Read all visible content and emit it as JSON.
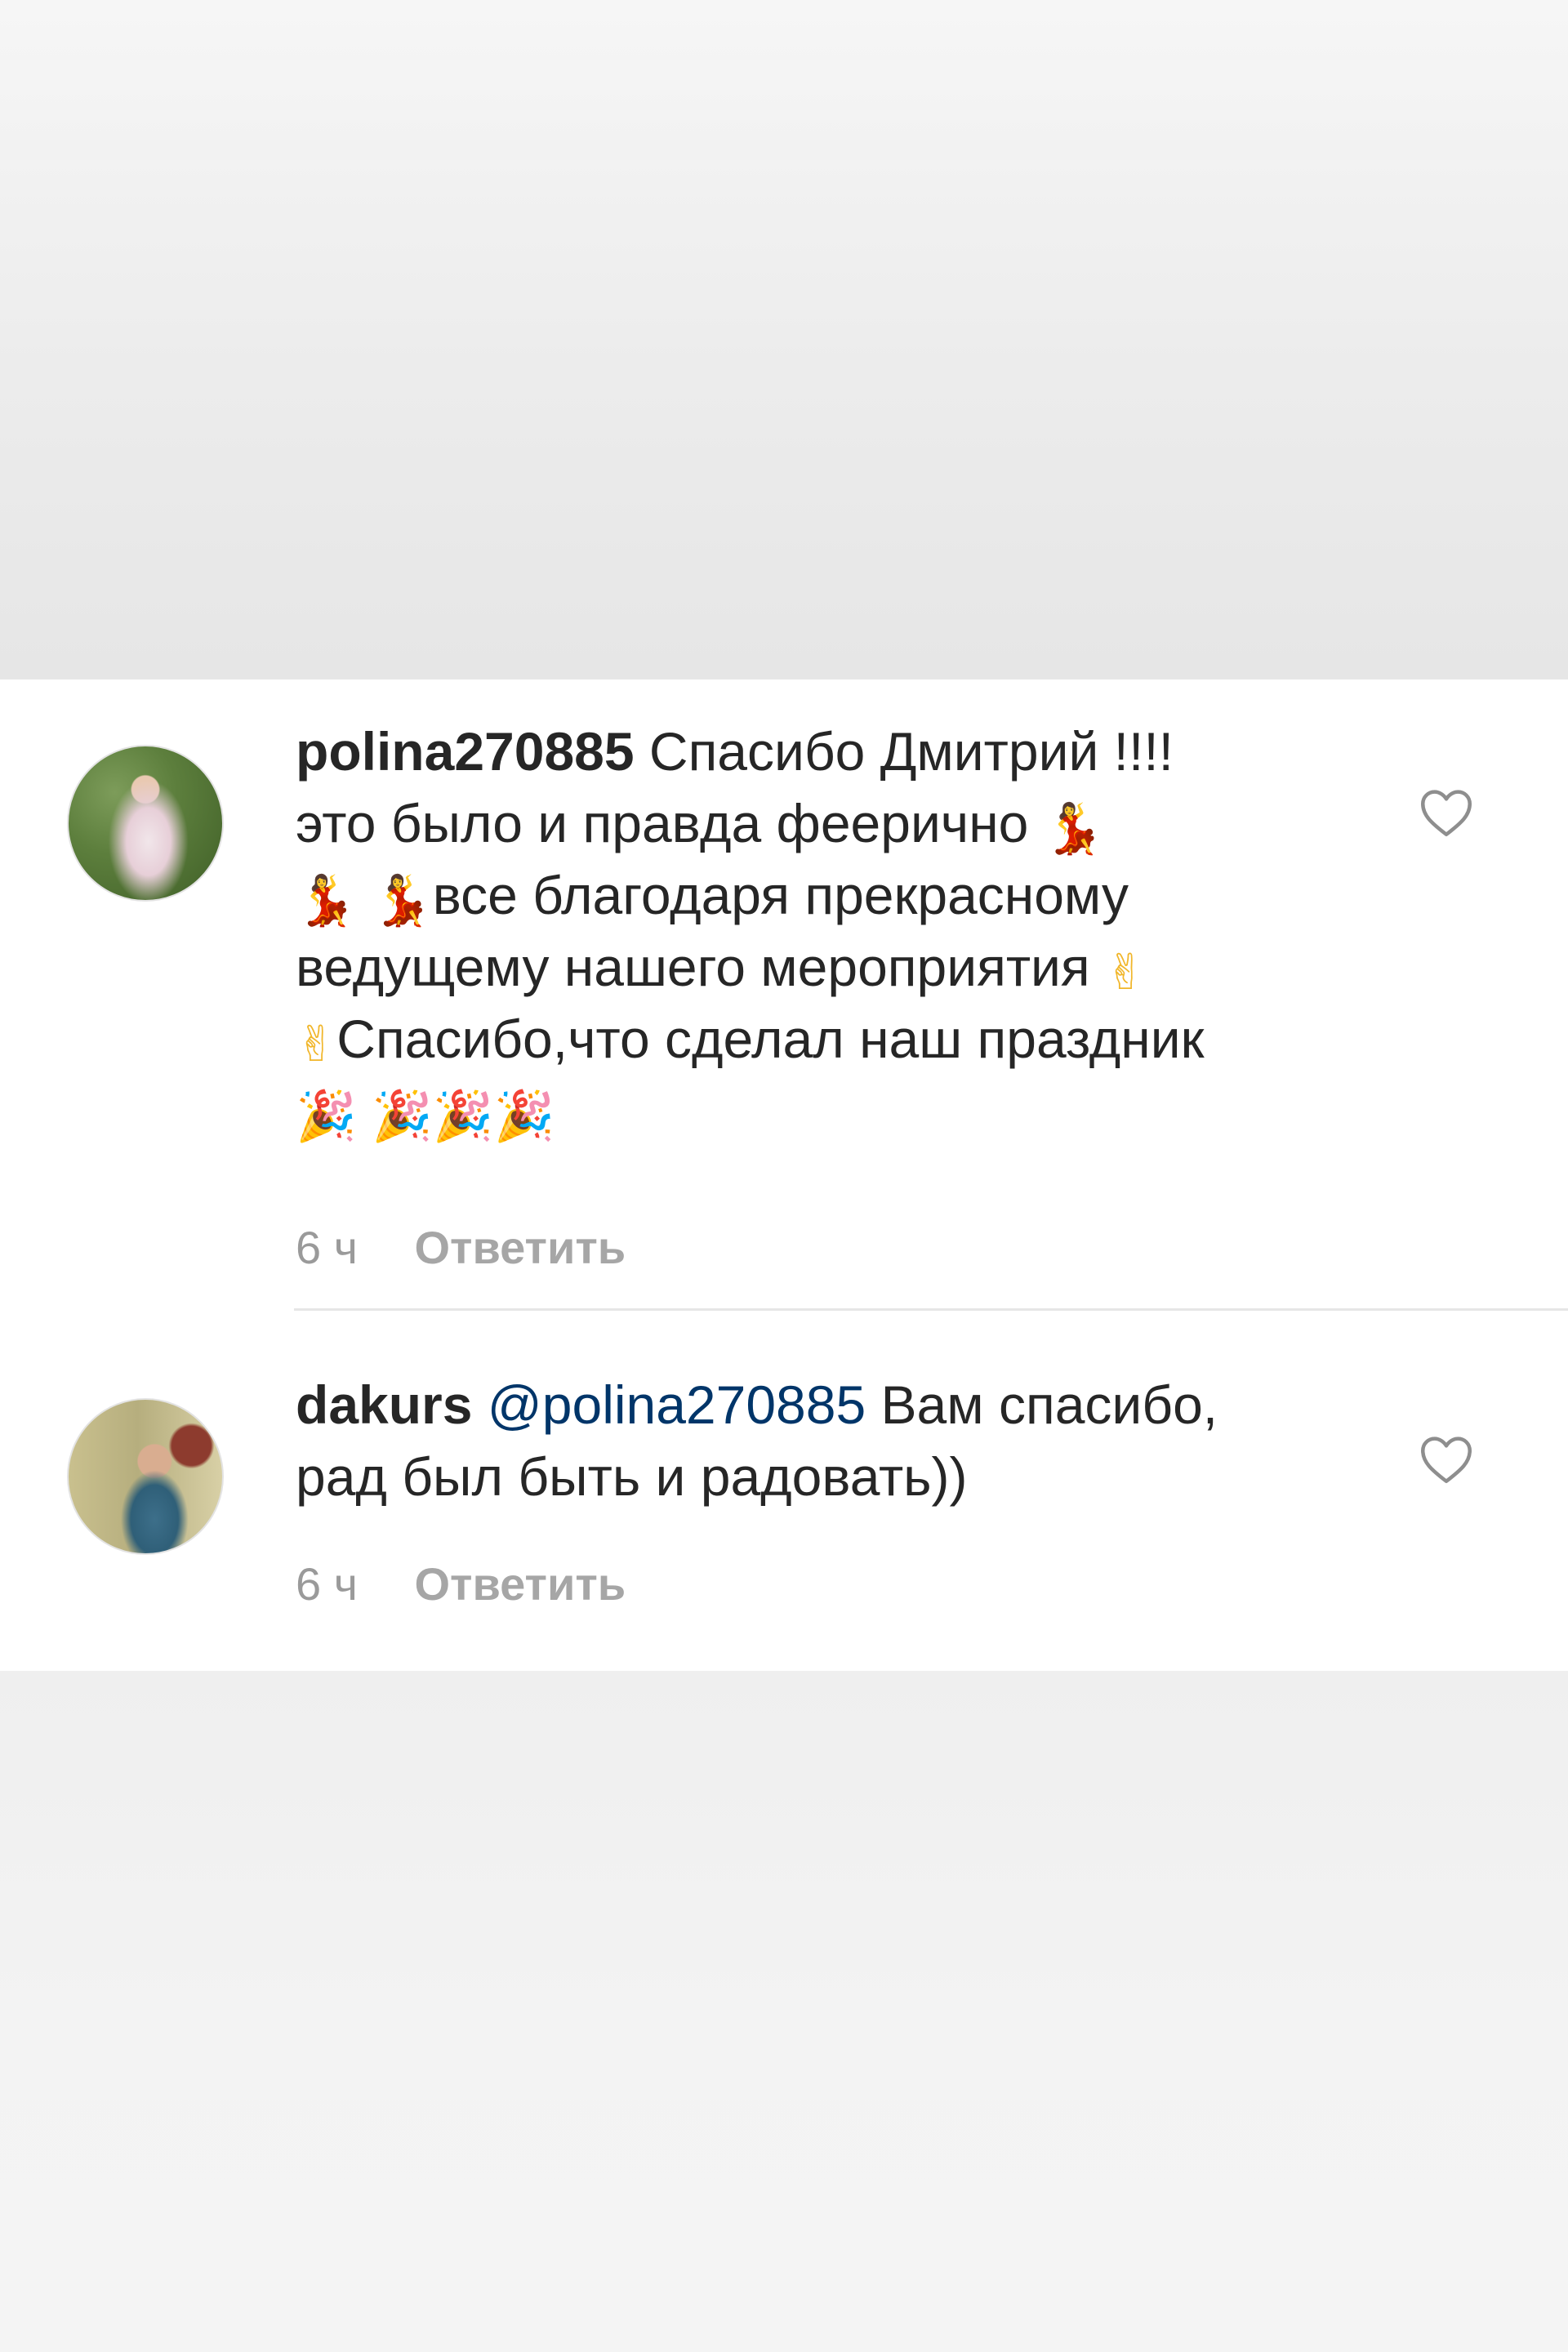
{
  "comments": [
    {
      "username": "polina270885",
      "lines": [
        {
          "text": "Спасибо Дмитрий !!!!"
        },
        {
          "text": "это было и правда феерично "
        },
        {
          "text": "все благодаря прекрасному"
        },
        {
          "text": "ведущему нашего мероприятия "
        },
        {
          "text": "Спасибо,что сделал наш праздник"
        }
      ],
      "emoji": {
        "dancer": "💃",
        "victory": "✌",
        "party": "🎉"
      },
      "time": "6 ч",
      "reply_label": "Ответить",
      "like_icon": "heart-outline-icon"
    },
    {
      "username": "dakurs",
      "mention": "@polina270885",
      "text_line1": " Вам спасибо,",
      "text_line2": "рад был быть и радовать))",
      "time": "6 ч",
      "reply_label": "Ответить",
      "like_icon": "heart-outline-icon"
    }
  ],
  "colors": {
    "text": "#262626",
    "mention": "#003569",
    "meta": "#9a9a9a",
    "divider": "#e6e6e6",
    "backdrop": "#ececec"
  }
}
